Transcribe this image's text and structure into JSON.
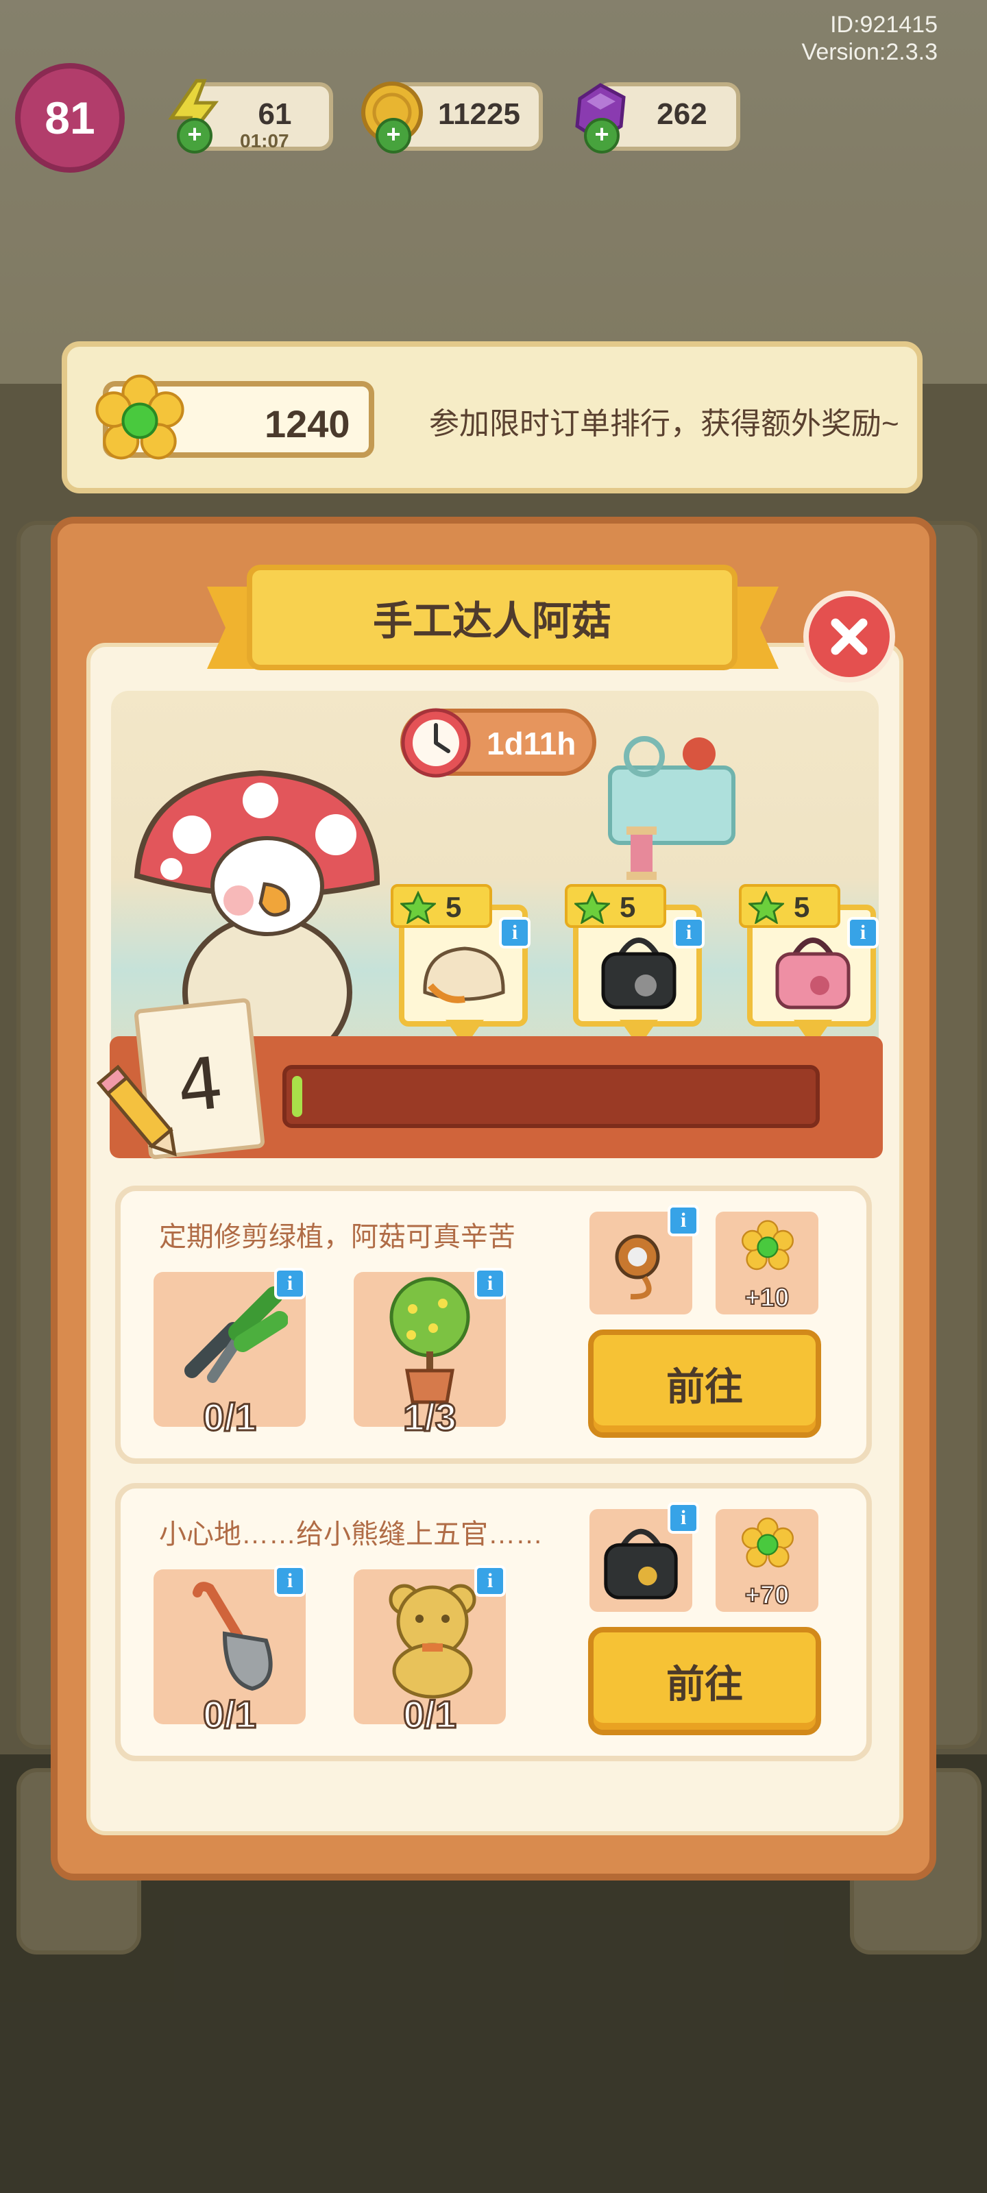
{
  "header": {
    "id_text": "ID:921415",
    "version_text": "Version:2.3.3"
  },
  "hud": {
    "level": "81",
    "energy": {
      "value": "61",
      "timer": "01:07"
    },
    "coins": {
      "value": "11225"
    },
    "gems": {
      "value": "262"
    }
  },
  "banner": {
    "score": "1240",
    "message": "参加限时订单排行，获得额外奖励~"
  },
  "panel": {
    "title": "手工达人阿菇",
    "timer": "1d11h",
    "stage": "4",
    "progress_fraction": 0.02,
    "requirements": [
      {
        "level": "5",
        "item": "bread-item-icon"
      },
      {
        "level": "5",
        "item": "black-bag-icon"
      },
      {
        "level": "5",
        "item": "pink-bag-icon"
      }
    ]
  },
  "tasks": [
    {
      "description": "定期修剪绿植，阿菇可真辛苦",
      "items": [
        {
          "icon": "pruning-shears-icon",
          "count": "0/1"
        },
        {
          "icon": "potted-tree-icon",
          "count": "1/3"
        }
      ],
      "reward_amount": "+10",
      "go_label": "前往"
    },
    {
      "description": "小心地……给小熊缝上五官……",
      "items": [
        {
          "icon": "shovel-icon",
          "count": "0/1"
        },
        {
          "icon": "teddy-bear-icon",
          "count": "0/1"
        }
      ],
      "reward_amount": "+70",
      "go_label": "前往"
    }
  ],
  "colors": {
    "panel": "#d98b4e",
    "title_plate": "#f8d14f",
    "go_button": "#f6c235",
    "close_button": "#e4504f",
    "info_badge": "#37a3e7"
  }
}
